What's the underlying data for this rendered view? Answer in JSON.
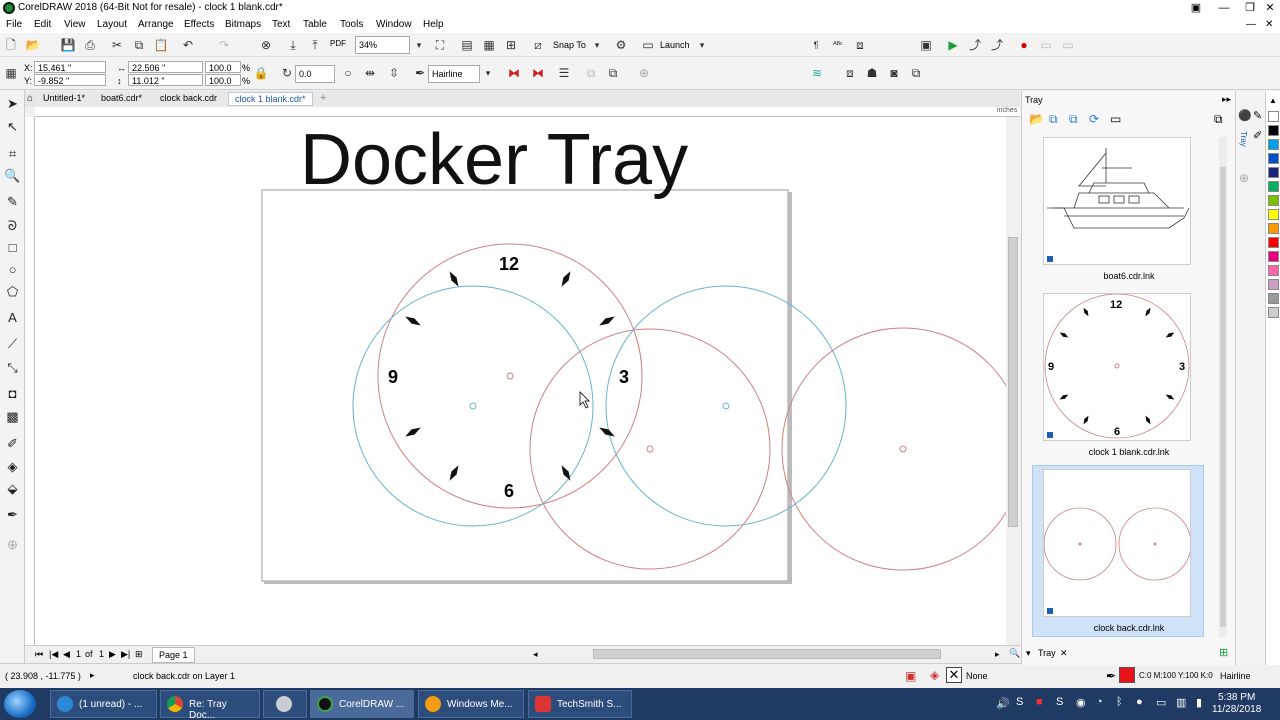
{
  "window": {
    "title": "CorelDRAW 2018 (64-Bit Not for resale) - clock 1 blank.cdr*"
  },
  "menu": [
    "File",
    "Edit",
    "View",
    "Layout",
    "Arrange",
    "Effects",
    "Bitmaps",
    "Text",
    "Table",
    "Tools",
    "Window",
    "Help"
  ],
  "toolbar": {
    "zoom_value": "34%",
    "snap_label": "Snap To",
    "launch_label": "Launch",
    "pdf_label": "PDF"
  },
  "property_bar": {
    "x": "15.461 \"",
    "y": "-9.852 \"",
    "width": "22.506 \"",
    "height": "11.012 \"",
    "scale_x": "100.0",
    "scale_y": "100.0",
    "percent": "%",
    "rotation": "0.0",
    "outline": "Hairline"
  },
  "tabs": [
    "Untitled-1*",
    "boat6.cdr*",
    "clock back.cdr",
    "clock 1 blank.cdr*"
  ],
  "ruler_unit": "inches",
  "canvas": {
    "heading": "Docker Tray",
    "clock_numbers": {
      "n12": "12",
      "n3": "3",
      "n6": "6",
      "n9": "9"
    }
  },
  "page_nav": {
    "current": "1",
    "of": "of",
    "total": "1",
    "page_tab": "Page 1"
  },
  "status": {
    "coords": "( 23.908 , -11.775 )",
    "layer_info": "clock back.cdr on Layer 1",
    "fill_none": "None",
    "outline_color": "C:0 M:100 Y:100 K:0",
    "outline_width": "Hairline"
  },
  "tray": {
    "title": "Tray",
    "tab_label": "Tray",
    "side_label": "Tray",
    "items": [
      {
        "label": "boat6.cdr.lnk"
      },
      {
        "label": "clock 1 blank.cdr.lnk",
        "numbers": {
          "n12": "12",
          "n3": "3",
          "n6": "6",
          "n9": "9"
        }
      },
      {
        "label": "clock back.cdr.lnk"
      }
    ]
  },
  "palette_colors": [
    "#ffffff",
    "#000000",
    "#00a0e9",
    "#0050c8",
    "#1a237e",
    "#00b060",
    "#7cc000",
    "#ffff00",
    "#ff9900",
    "#ff0000",
    "#e6007e",
    "#ff66aa",
    "#c8a0c8",
    "#999999",
    "#cccccc"
  ],
  "taskbar": {
    "tasks": [
      "(1 unread) - ...",
      "Re: Tray Doc...",
      "",
      "CorelDRAW ...",
      "Windows Me...",
      "TechSmith S..."
    ],
    "time": "5:38 PM",
    "date": "11/28/2018"
  }
}
